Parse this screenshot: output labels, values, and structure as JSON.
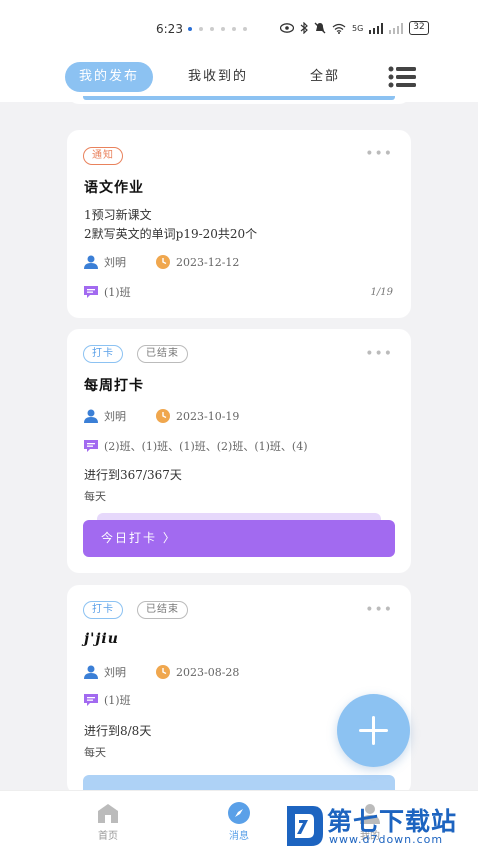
{
  "status_bar": {
    "time": "6:23",
    "signal": "5G",
    "battery": "32"
  },
  "tabs": {
    "mine": "我的发布",
    "received": "我收到的",
    "all": "全部"
  },
  "cards": [
    {
      "tags": [
        "通知"
      ],
      "title": "语文作业",
      "lines": [
        "1预习新课文",
        "2默写英文的单词p19-20共20个"
      ],
      "author": "刘明",
      "date": "2023-12-12",
      "classes": "(1)班",
      "page": "1/19"
    },
    {
      "tags": [
        "打卡",
        "已结束"
      ],
      "title": "每周打卡",
      "author": "刘明",
      "date": "2023-10-19",
      "classes": "(2)班、(1)班、(1)班、(2)班、(1)班、(4)",
      "progress": "进行到367/367天",
      "frequency": "每天",
      "button": "今日打卡 〉"
    },
    {
      "tags": [
        "打卡",
        "已结束"
      ],
      "title": "j'jiu",
      "author": "刘明",
      "date": "2023-08-28",
      "classes": "(1)班",
      "progress": "进行到8/8天",
      "frequency": "每天"
    }
  ],
  "bottom_nav": {
    "home": "首页",
    "messages": "消息",
    "mine": "我的"
  },
  "watermark": {
    "title": "第七下载站",
    "url": "www.d7down.com"
  },
  "colors": {
    "accent": "#8cc2f2",
    "purple": "#a26af0",
    "orange": "#e9825c",
    "person": "#3b7fd6",
    "clock": "#f0a74e"
  }
}
